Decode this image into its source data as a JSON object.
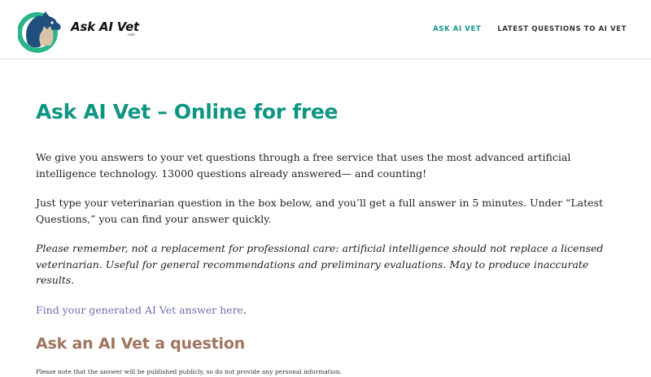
{
  "header": {
    "logo_icon": "dog-and-cat-logo-icon",
    "site_title": "Ask AI Vet",
    "site_sub": ".com",
    "nav": [
      {
        "label": "ASK AI VET",
        "active": true
      },
      {
        "label": "LATEST QUESTIONS TO AI VET",
        "active": false
      }
    ]
  },
  "main": {
    "title": "Ask AI Vet – Online for free",
    "intro": "We give you answers to your vet questions through a free service that uses the most advanced artificial intelligence technology. 13000 questions already answered— and counting!",
    "instructions": "Just type your veterinarian question in the box below, and you’ll get a full answer in 5 minutes. Under “Latest Questions,” you can find your answer quickly.",
    "disclaimer": "Please remember, not a replacement for professional care: artificial intelligence should not replace a licensed veterinarian. Useful for general recommendations and preliminary evaluations. May to produce inaccurate results.",
    "answer_link": "Find your generated AI Vet answer here",
    "answer_link_suffix": ".",
    "section_title": "Ask an AI Vet a question",
    "notice": "Please note that the answer will be published publicly, so do not provide any personal information."
  },
  "colors": {
    "accent": "#0f9683",
    "section_title": "#a07460",
    "link": "#6c6fb1"
  }
}
